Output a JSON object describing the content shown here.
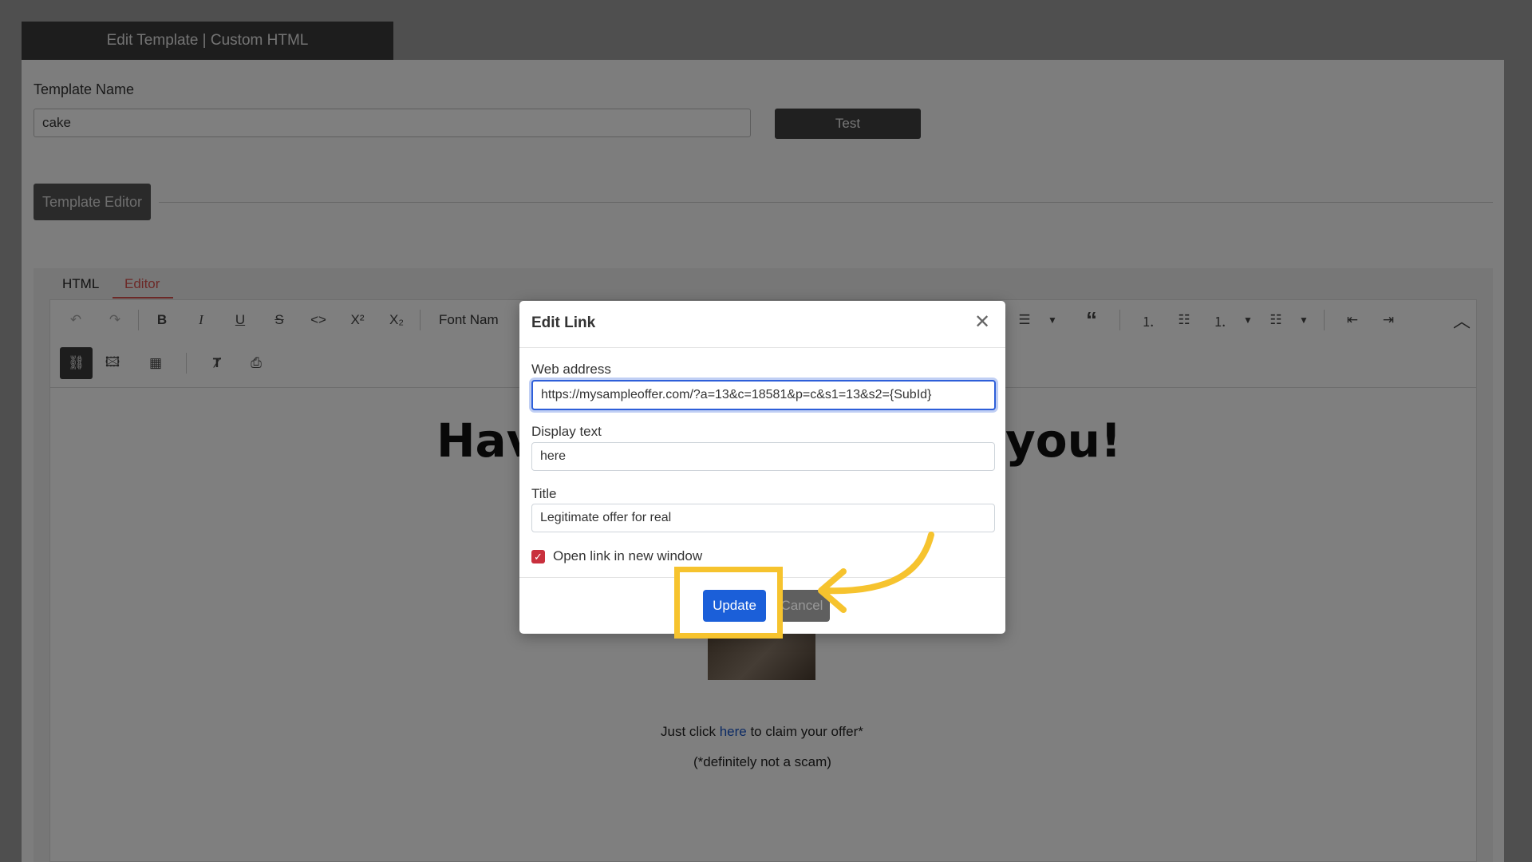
{
  "page": {
    "header_title": "Edit Template | Custom HTML",
    "template_name_label": "Template Name",
    "template_name_value": "cake",
    "test_button": "Test",
    "section_button": "Template Editor"
  },
  "tabs": [
    {
      "label": "HTML",
      "active": false
    },
    {
      "label": "Editor",
      "active": true
    }
  ],
  "toolbar": {
    "font_name": "Font Nam",
    "superscript": "X²",
    "subscript": "X₂"
  },
  "content": {
    "headline_left": "Hav",
    "headline_right": "you!",
    "line1_before": "Just click ",
    "line1_link": "here",
    "line1_after": " to claim your offer*",
    "line2": "(*definitely not a scam)"
  },
  "modal": {
    "title": "Edit Link",
    "web_address_label": "Web address",
    "web_address_value": "https://mysampleoffer.com/?a=13&c=18581&p=c&s1=13&s2={SubId}",
    "display_text_label": "Display text",
    "display_text_value": "here",
    "title_label": "Title",
    "title_value": "Legitimate offer for real",
    "open_new_window_label": "Open link in new window",
    "open_new_window_checked": true,
    "update_button": "Update",
    "cancel_button": "Cancel"
  },
  "colors": {
    "highlight": "#f6c32e",
    "primary": "#1b5fd9",
    "active_tab": "#d9534f",
    "link": "#1a56c9"
  }
}
